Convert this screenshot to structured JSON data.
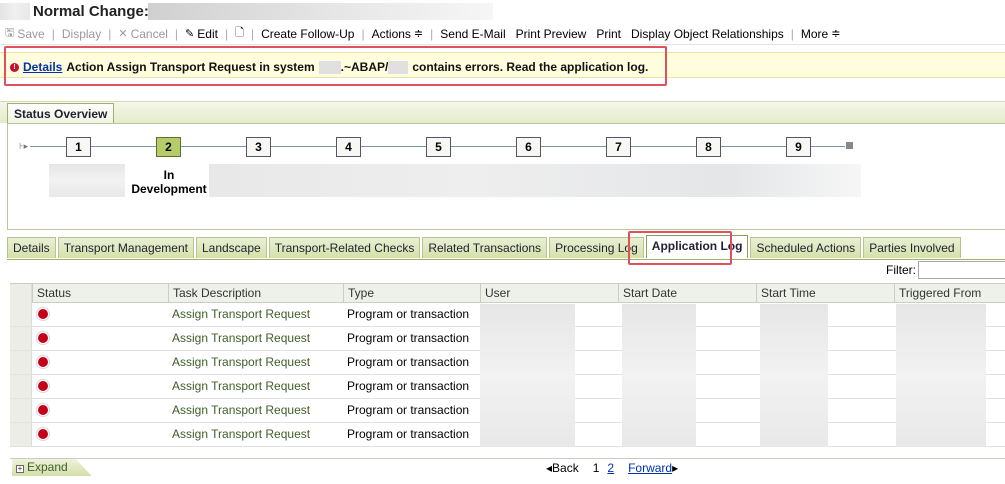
{
  "title": {
    "text": "Normal Change:"
  },
  "toolbar": {
    "save": "Save",
    "display": "Display",
    "cancel": "Cancel",
    "edit": "Edit",
    "create_follow_up": "Create Follow-Up",
    "actions": "Actions",
    "send_email": "Send E-Mail",
    "print_preview": "Print Preview",
    "print": "Print",
    "display_object_relationships": "Display Object Relationships",
    "more": "More"
  },
  "message": {
    "link": "Details",
    "part1": "Action Assign Transport Request in system",
    "part2": ".~ABAP/",
    "part3": "contains errors. Read the application log."
  },
  "status_overview": {
    "tab_label": "Status Overview",
    "steps": [
      "1",
      "2",
      "3",
      "4",
      "5",
      "6",
      "7",
      "8",
      "9"
    ],
    "active_step": 2,
    "active_label": "In Development"
  },
  "tabs": [
    "Details",
    "Transport Management",
    "Landscape",
    "Transport-Related Checks",
    "Related Transactions",
    "Processing Log",
    "Application Log",
    "Scheduled Actions",
    "Parties Involved"
  ],
  "selected_tab": "Application Log",
  "filter": {
    "label": "Filter:"
  },
  "table": {
    "headers": [
      "Status",
      "Task Description",
      "Type",
      "User",
      "Start Date",
      "Start Time",
      "Triggered From"
    ],
    "rows": [
      {
        "status": "error",
        "task": "Assign Transport Request",
        "type": "Program or transaction"
      },
      {
        "status": "error",
        "task": "Assign Transport Request",
        "type": "Program or transaction"
      },
      {
        "status": "error",
        "task": "Assign Transport Request",
        "type": "Program or transaction"
      },
      {
        "status": "error",
        "task": "Assign Transport Request",
        "type": "Program or transaction"
      },
      {
        "status": "error",
        "task": "Assign Transport Request",
        "type": "Program or transaction"
      },
      {
        "status": "error",
        "task": "Assign Transport Request",
        "type": "Program or transaction"
      }
    ]
  },
  "footer": {
    "expand": "Expand",
    "back": "Back",
    "page1": "1",
    "page2": "2",
    "forward": "Forward"
  },
  "colors": {
    "accent_green": "#d5e1a9",
    "highlight_red": "#e0515b",
    "error_red": "#c4001a",
    "link_blue": "#0033aa",
    "message_bg": "#fffdde"
  },
  "icons": {
    "save": "floppy-icon",
    "cancel": "x-icon",
    "edit": "pencil-icon",
    "copy": "document-icon",
    "error": "error-circle-icon",
    "status": "red-status-icon"
  }
}
